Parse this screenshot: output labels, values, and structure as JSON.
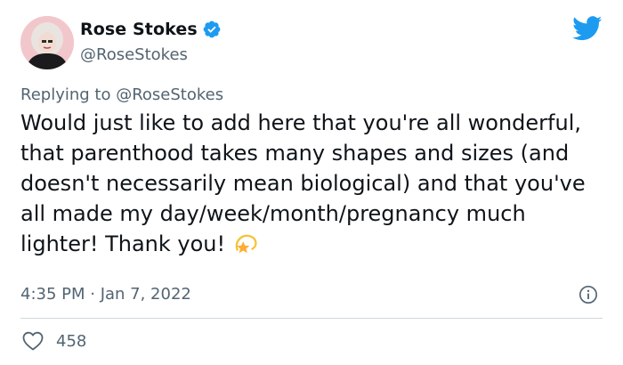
{
  "author": {
    "display_name": "Rose Stokes",
    "handle": "@RoseStokes",
    "avatar_icon": "avatar-photo",
    "verified_icon": "verified-badge-icon"
  },
  "reply": {
    "prefix": "Replying to",
    "target": "@RoseStokes"
  },
  "tweet": {
    "text": "Would just like to add here that you're all wonderful, that parenthood takes many shapes and sizes (and doesn't necessarily mean biological) and that you've all made my day/week/month/pregnancy much lighter! Thank you!",
    "emoji_icon": "dizzy-star-icon",
    "timestamp": "4:35 PM · Jan 7, 2022"
  },
  "actions": {
    "likes": "458",
    "like_icon": "heart-icon",
    "info_icon": "info-icon"
  },
  "brand": {
    "logo_icon": "twitter-bird-icon",
    "accent": "#1d9bf0",
    "text_secondary": "#536471",
    "text_primary": "#0f1419",
    "divider": "#cfd9de"
  }
}
